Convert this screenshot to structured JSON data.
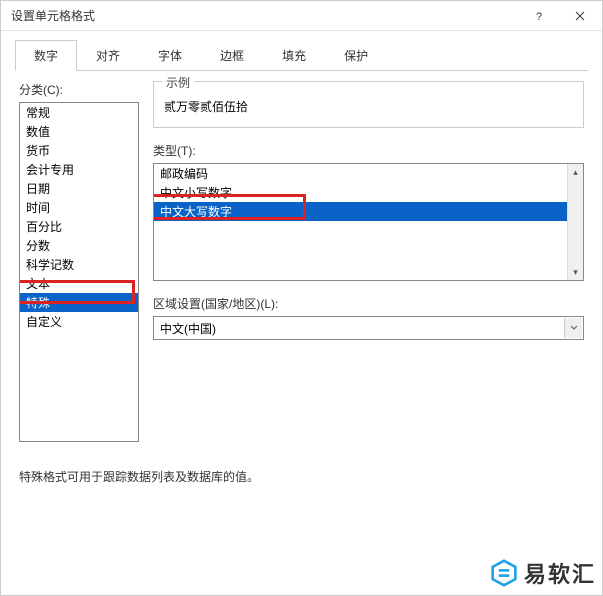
{
  "title": "设置单元格格式",
  "tabs": [
    {
      "label": "数字",
      "active": true
    },
    {
      "label": "对齐",
      "active": false
    },
    {
      "label": "字体",
      "active": false
    },
    {
      "label": "边框",
      "active": false
    },
    {
      "label": "填充",
      "active": false
    },
    {
      "label": "保护",
      "active": false
    }
  ],
  "category": {
    "label": "分类(C):",
    "items": [
      "常规",
      "数值",
      "货币",
      "会计专用",
      "日期",
      "时间",
      "百分比",
      "分数",
      "科学记数",
      "文本",
      "特殊",
      "自定义"
    ],
    "selected_index": 10
  },
  "sample": {
    "group_title": "示例",
    "value": "贰万零贰佰伍拾"
  },
  "type": {
    "label": "类型(T):",
    "items": [
      "邮政编码",
      "中文小写数字",
      "中文大写数字"
    ],
    "selected_index": 2
  },
  "locale": {
    "label": "区域设置(国家/地区)(L):",
    "value": "中文(中国)"
  },
  "description": "特殊格式可用于跟踪数据列表及数据库的值。",
  "watermark": {
    "text": "易软汇"
  }
}
